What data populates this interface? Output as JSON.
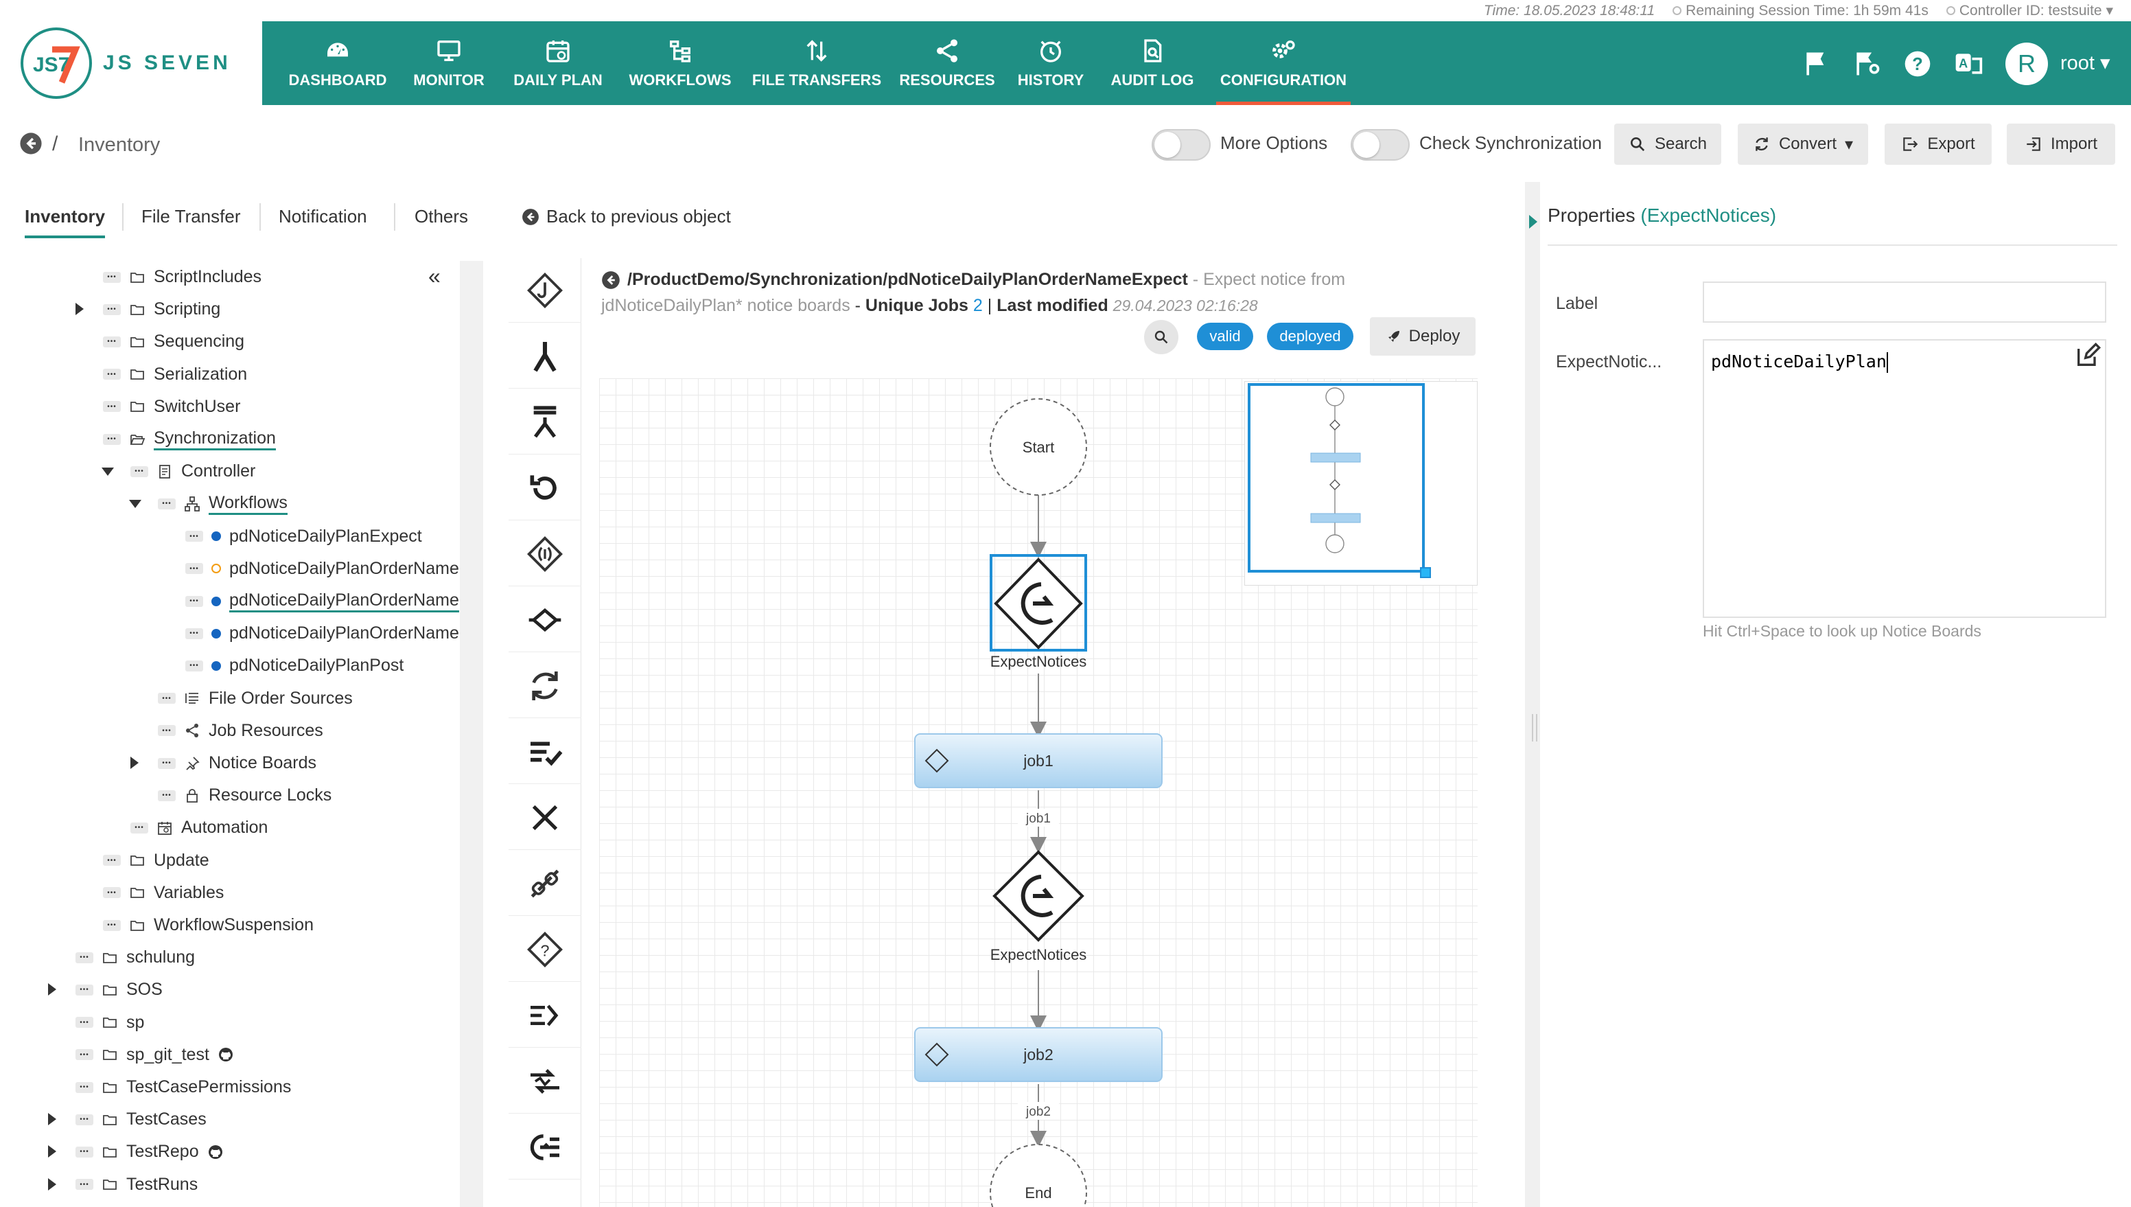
{
  "status": {
    "time": "Time: 18.05.2023 18:48:11",
    "session": "Remaining Session Time: 1h 59m 41s",
    "controller": "Controller ID: testsuite"
  },
  "brand": {
    "name": "JS SEVEN",
    "mark": "JS7"
  },
  "nav": [
    {
      "label": "DASHBOARD",
      "icon": "dashboard-icon"
    },
    {
      "label": "MONITOR",
      "icon": "monitor-icon"
    },
    {
      "label": "DAILY PLAN",
      "icon": "calendar-icon"
    },
    {
      "label": "WORKFLOWS",
      "icon": "workflow-icon"
    },
    {
      "label": "FILE TRANSFERS",
      "icon": "transfer-icon"
    },
    {
      "label": "RESOURCES",
      "icon": "share-icon"
    },
    {
      "label": "HISTORY",
      "icon": "history-icon"
    },
    {
      "label": "AUDIT LOG",
      "icon": "audit-icon"
    },
    {
      "label": "CONFIGURATION",
      "icon": "gear-icon",
      "active": true
    }
  ],
  "user": {
    "initial": "R",
    "name": "root"
  },
  "breadcrumb": {
    "sep": "/",
    "title": "Inventory"
  },
  "toolbar": {
    "more_options": "More Options",
    "check_sync": "Check Synchronization",
    "search": "Search",
    "convert": "Convert",
    "export": "Export",
    "import": "Import"
  },
  "left_tabs": [
    "Inventory",
    "File Transfer",
    "Notification",
    "Others"
  ],
  "back_previous": "Back to previous object",
  "tree": [
    {
      "label": "ScriptIncludes"
    },
    {
      "label": "Scripting"
    },
    {
      "label": "Sequencing"
    },
    {
      "label": "Serialization"
    },
    {
      "label": "SwitchUser"
    },
    {
      "label": "Synchronization"
    },
    {
      "label": "Controller"
    },
    {
      "label": "Workflows"
    },
    {
      "label": "pdNoticeDailyPlanExpect"
    },
    {
      "label": "pdNoticeDailyPlanOrderName"
    },
    {
      "label": "pdNoticeDailyPlanOrderName"
    },
    {
      "label": "pdNoticeDailyPlanOrderName"
    },
    {
      "label": "pdNoticeDailyPlanPost"
    },
    {
      "label": "File Order Sources"
    },
    {
      "label": "Job Resources"
    },
    {
      "label": "Notice Boards"
    },
    {
      "label": "Resource Locks"
    },
    {
      "label": "Automation"
    },
    {
      "label": "Update"
    },
    {
      "label": "Variables"
    },
    {
      "label": "WorkflowSuspension"
    },
    {
      "label": "schulung"
    },
    {
      "label": "SOS"
    },
    {
      "label": "sp"
    },
    {
      "label": "sp_git_test"
    },
    {
      "label": "TestCasePermissions"
    },
    {
      "label": "TestCases"
    },
    {
      "label": "TestRepo"
    },
    {
      "label": "TestRuns"
    }
  ],
  "editor": {
    "path": "/ProductDemo/Synchronization/pdNoticeDailyPlanOrderNameExpect",
    "description": " - Expect notice from jdNoticeDailyPlan* notice boards",
    "dash": " - ",
    "unique_jobs_label": "Unique Jobs",
    "unique_jobs": "2",
    "sep": "|",
    "last_modified_label": "Last modified",
    "last_modified": "29.04.2023 02:16:28",
    "badge_valid": "valid",
    "badge_deployed": "deployed",
    "deploy": "Deploy"
  },
  "workflow": {
    "start": "Start",
    "expect1": "ExpectNotices",
    "job1": "job1",
    "job1_edge": "job1",
    "expect2": "ExpectNotices",
    "job2": "job2",
    "job2_edge": "job2",
    "end": "End"
  },
  "properties": {
    "title": "Properties",
    "title_type": "(ExpectNotices)",
    "label_field": "Label",
    "label_value": "",
    "notice_field": "ExpectNotic...",
    "notice_value": "pdNoticeDailyPlan",
    "hint": "Hit Ctrl+Space to look up Notice Boards"
  },
  "colors": {
    "brand": "#1f8f84",
    "accent": "#f15a3a",
    "badge": "#1f8fd6"
  }
}
